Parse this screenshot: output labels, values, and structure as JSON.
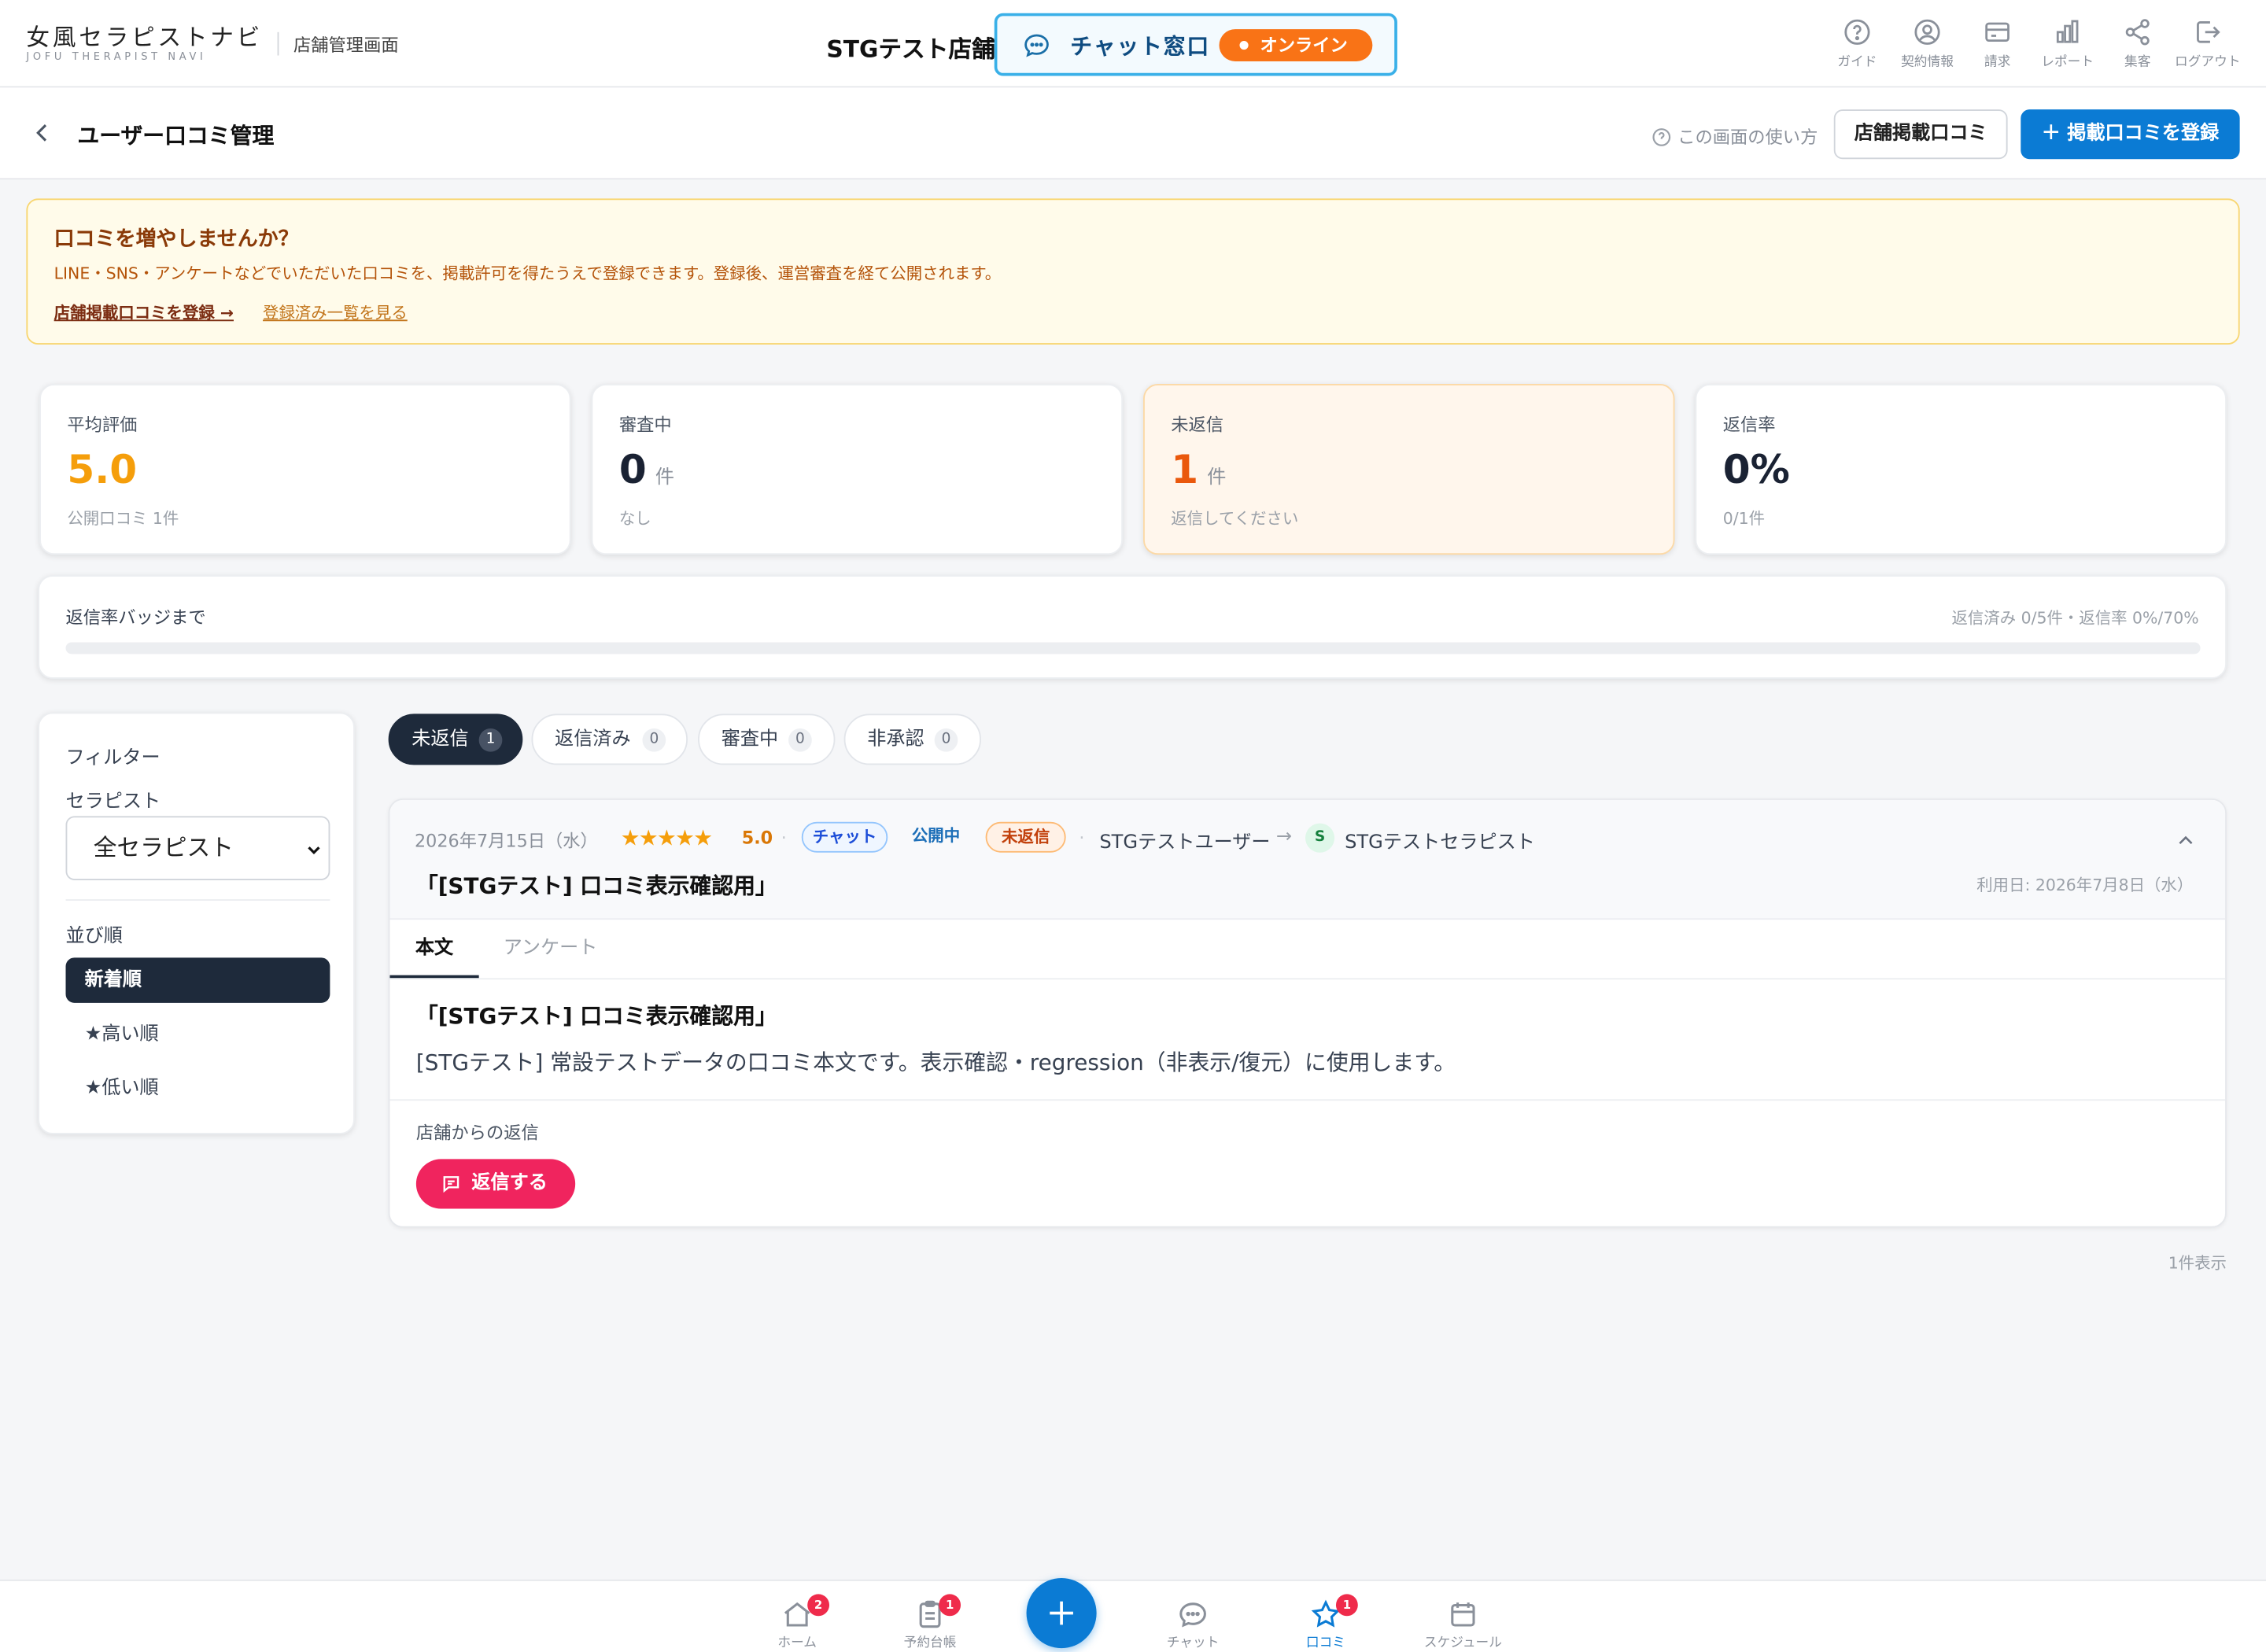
{
  "header": {
    "logo": "女風セラピストナビ",
    "logo_sub": "JOFU THERAPIST NAVI",
    "tag": "店舗管理画面",
    "store_name": "STGテスト店舗",
    "chat_label": "チャット窓口",
    "online_label": "オンライン",
    "nav": [
      {
        "label": "ガイド",
        "icon": "help-circle-icon"
      },
      {
        "label": "契約情報",
        "icon": "user-circle-icon"
      },
      {
        "label": "請求",
        "icon": "credit-card-icon"
      },
      {
        "label": "レポート",
        "icon": "bar-chart-icon"
      },
      {
        "label": "集客",
        "icon": "share-icon"
      },
      {
        "label": "ログアウト",
        "icon": "logout-icon"
      }
    ]
  },
  "subheader": {
    "title": "ユーザー口コミ管理",
    "help": "この画面の使い方",
    "store_reviews_button": "店舗掲載口コミ",
    "register_button": "＋ 掲載口コミを登録"
  },
  "banner": {
    "title": "口コミを増やしませんか？",
    "description": "LINE・SNS・アンケートなどでいただいた口コミを、掲載許可を得たうえで登録できます。登録後、運営審査を経て公開されます。",
    "link_register": "店舗掲載口コミを登録 →",
    "link_list": "登録済み一覧を見る"
  },
  "stats": [
    {
      "label": "平均評価",
      "value": "5.0",
      "unit": "",
      "sub": "公開口コミ 1件",
      "color": "#f59e0b"
    },
    {
      "label": "審査中",
      "value": "0",
      "unit": "件",
      "sub": "なし",
      "color": "#1a2233"
    },
    {
      "label": "未返信",
      "value": "1",
      "unit": "件",
      "sub": "返信してください",
      "color": "#ea580c"
    },
    {
      "label": "返信率",
      "value": "0%",
      "unit": "",
      "sub": "0/1件",
      "color": "#1a2233"
    }
  ],
  "progress": {
    "label": "返信率バッジまで",
    "detail": "返信済み 0/5件・返信率 0%/70%",
    "fraction": 0
  },
  "filter": {
    "title": "フィルター",
    "therapist_label": "セラピスト",
    "therapist_selected": "全セラピスト",
    "sort_label": "並び順",
    "sort_options": [
      "新着順",
      "★高い順",
      "★低い順"
    ]
  },
  "tabs": [
    {
      "label": "未返信",
      "count": "1"
    },
    {
      "label": "返信済み",
      "count": "0"
    },
    {
      "label": "審査中",
      "count": "0"
    },
    {
      "label": "非承認",
      "count": "0"
    }
  ],
  "review": {
    "date": "2026年7月15日（水）",
    "stars": "★★★★★",
    "score": "5.0",
    "chip_chat": "チャット",
    "chip_public": "公開中",
    "chip_unreplied": "未返信",
    "user": "STGテストユーザー",
    "arrow": "→",
    "avatar_letter": "S",
    "therapist": "STGテストセラピスト",
    "title": "「[STGテスト] 口コミ表示確認用」",
    "used_date": "利用日: 2026年7月8日（水）",
    "tab_body": "本文",
    "tab_survey": "アンケート",
    "body_title": "「[STGテスト] 口コミ表示確認用」",
    "body": "[STGテスト] 常設テストデータの口コミ本文です。表示確認・regression（非表示/復元）に使用します。",
    "reply_label": "店舗からの返信",
    "reply_button": "返信する"
  },
  "result_count": "1件表示",
  "bottom_nav": [
    {
      "label": "ホーム",
      "badge": "2",
      "icon": "home-icon"
    },
    {
      "label": "予約台帳",
      "badge": "1",
      "icon": "clipboard-icon"
    },
    {
      "label": "チャット",
      "badge": "",
      "icon": "chat-icon"
    },
    {
      "label": "口コミ",
      "badge": "1",
      "icon": "star-icon"
    },
    {
      "label": "スケジュール",
      "badge": "",
      "icon": "calendar-icon"
    }
  ]
}
